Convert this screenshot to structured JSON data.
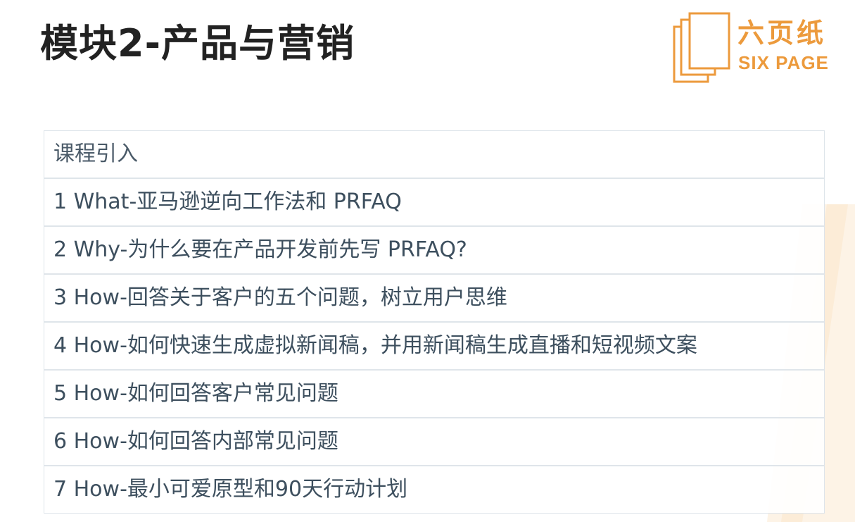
{
  "title": "模块2-产品与营销",
  "logo": {
    "name_cn": "六页纸",
    "name_en": "SIX PAGE"
  },
  "colors": {
    "title": "#222222",
    "brand_orange": "#ec9a3c",
    "row_text": "#3d4f5e",
    "row_border": "#dfe5ea"
  },
  "toc": {
    "items": [
      "课程引入",
      "1 What-亚马逊逆向工作法和 PRFAQ",
      "2 Why-为什么要在产品开发前先写 PRFAQ?",
      "3 How-回答关于客户的五个问题，树立用户思维",
      "4 How-如何快速生成虚拟新闻稿，并用新闻稿生成直播和短视频文案",
      "5 How-如何回答客户常见问题",
      "6 How-如何回答内部常见问题",
      "7 How-最小可爱原型和90天行动计划"
    ]
  }
}
